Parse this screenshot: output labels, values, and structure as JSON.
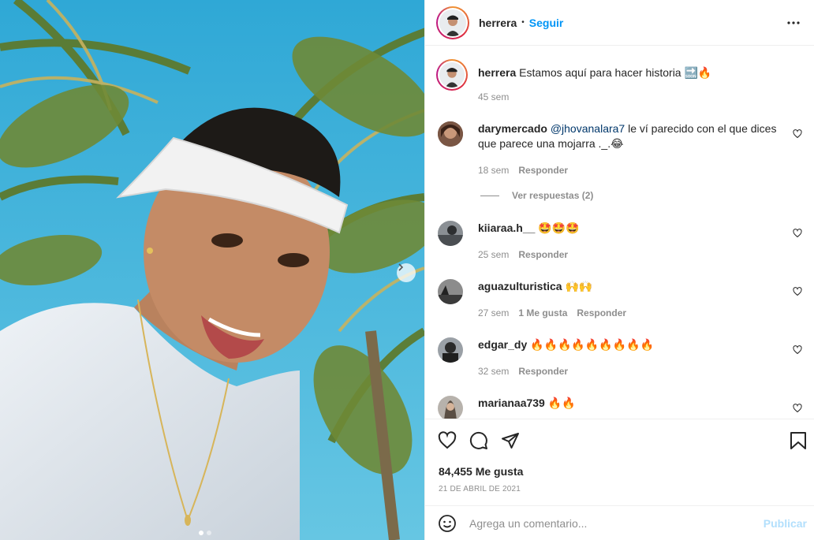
{
  "post": {
    "image_alt": "selfie-with-palm-trees",
    "carousel_total": 2,
    "carousel_active": 1
  },
  "header": {
    "username": "herrera",
    "separator": "•",
    "follow_label": "Seguir",
    "more_icon": "more-horizontal-icon"
  },
  "caption": {
    "username": "herrera",
    "text": "Estamos aquí para hacer historia 🔜🔥",
    "time": "45 sem"
  },
  "comments": [
    {
      "username": "darymercado",
      "mention": "@jhovanalara7",
      "text": " le ví parecido con el que dices que parece una mojarra ._.😂",
      "time": "18 sem",
      "likes": "",
      "reply": "Responder"
    },
    {
      "username": "kiiaraa.h__",
      "mention": "",
      "text": "🤩🤩🤩",
      "time": "25 sem",
      "likes": "",
      "reply": "Responder"
    },
    {
      "username": "aguazulturistica",
      "mention": "",
      "text": "🙌🙌",
      "time": "27 sem",
      "likes": "1 Me gusta",
      "reply": "Responder"
    },
    {
      "username": "edgar_dy",
      "mention": "",
      "text": "🔥🔥🔥🔥🔥🔥🔥🔥🔥",
      "time": "32 sem",
      "likes": "",
      "reply": "Responder"
    },
    {
      "username": "marianaa739",
      "mention": "",
      "text": "🔥🔥",
      "time": "",
      "likes": "",
      "reply": ""
    }
  ],
  "view_replies": "Ver respuestas (2)",
  "actions": {
    "like_icon": "heart-icon",
    "comment_icon": "comment-icon",
    "share_icon": "paper-plane-icon",
    "save_icon": "bookmark-icon"
  },
  "likes_count": "84,455 Me gusta",
  "date": "21 DE ABRIL DE 2021",
  "add_comment": {
    "placeholder": "Agrega un comentario...",
    "publish_label": "Publicar",
    "emoji_icon": "smiley-icon"
  },
  "colors": {
    "link_blue": "#0095f6",
    "publish_disabled": "#b2dffc",
    "meta_gray": "#8e8e8e",
    "text": "#262626"
  }
}
